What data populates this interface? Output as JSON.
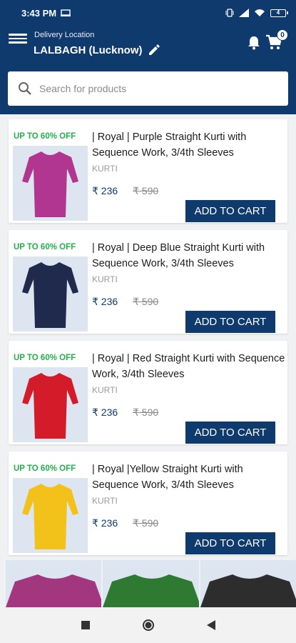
{
  "status_bar": {
    "time": "3:43 PM",
    "battery": "4"
  },
  "header": {
    "location_label": "Delivery Location",
    "location_value": "LALBAGH (Lucknow)",
    "cart_count": "0"
  },
  "search": {
    "placeholder": "Search for products",
    "value": ""
  },
  "products": [
    {
      "discount": "UP TO 60% OFF",
      "title": "| Royal | Purple Straight Kurti with Sequence Work, 3/4th Sleeves",
      "category": "KURTI",
      "price": "₹ 236",
      "mrp": "₹ 590",
      "button": "ADD TO CART",
      "color": "#b0368f"
    },
    {
      "discount": "UP TO 60% OFF",
      "title": "| Royal | Deep Blue Straight Kurti with Sequence Work, 3/4th Sleeves",
      "category": "KURTI",
      "price": "₹ 236",
      "mrp": "₹ 590",
      "button": "ADD TO CART",
      "color": "#1f2a4d"
    },
    {
      "discount": "UP TO 60% OFF",
      "title": "| Royal | Red Straight Kurti with Sequence Work, 3/4th Sleeves",
      "category": "KURTI",
      "price": "₹ 236",
      "mrp": "₹ 590",
      "button": "ADD TO CART",
      "color": "#d41b2a"
    },
    {
      "discount": "UP TO 60% OFF",
      "title": "| Royal |Yellow Straight Kurti with Sequence Work, 3/4th Sleeves",
      "category": "KURTI",
      "price": "₹ 236",
      "mrp": "₹ 590",
      "button": "ADD TO CART",
      "color": "#f2c21b"
    }
  ],
  "bottom_strip_colors": [
    "#a2367f",
    "#2f7a33",
    "#2d2d2d"
  ],
  "icons": {
    "menu": "hamburger-icon",
    "edit": "pencil-icon",
    "notifications": "bell-icon",
    "cart": "cart-icon",
    "search": "search-icon",
    "nav_recents": "square-icon",
    "nav_home": "circle-icon",
    "nav_back": "triangle-back-icon"
  },
  "colors": {
    "primary": "#0f3a6e",
    "discount": "#21b24a",
    "background": "#f0f1f3"
  }
}
